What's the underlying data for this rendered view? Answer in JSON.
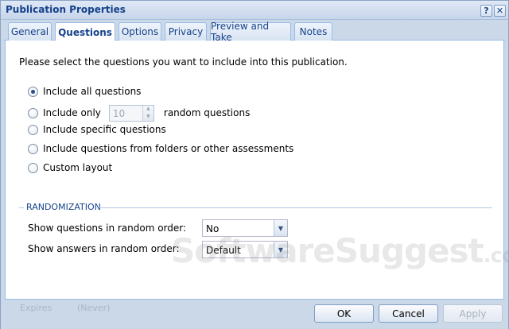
{
  "dialog": {
    "title": "Publication Properties",
    "help_glyph": "?",
    "close_glyph": "✕"
  },
  "tabs": [
    {
      "label": "General",
      "active": false
    },
    {
      "label": "Questions",
      "active": true
    },
    {
      "label": "Options",
      "active": false
    },
    {
      "label": "Privacy",
      "active": false
    },
    {
      "label": "Preview and Take",
      "active": false
    },
    {
      "label": "Notes",
      "active": false
    }
  ],
  "questions": {
    "intro": "Please select the questions you want to include into this publication.",
    "options": [
      {
        "label": "Include all questions",
        "checked": true
      },
      {
        "label": "Include only",
        "checked": false
      },
      {
        "label": "Include specific questions",
        "checked": false
      },
      {
        "label": "Include questions from folders or other assessments",
        "checked": false
      },
      {
        "label": "Custom layout",
        "checked": false
      }
    ],
    "include_only_count": "10",
    "include_only_suffix": "random questions"
  },
  "randomization": {
    "legend": "RANDOMIZATION",
    "questions_label": "Show questions in random order:",
    "questions_value": "No",
    "answers_label": "Show answers in random order:",
    "answers_value": "Default"
  },
  "footer": {
    "status_label": "Expires",
    "status_value": "(Never)",
    "ok_label": "OK",
    "cancel_label": "Cancel",
    "apply_label": "Apply"
  },
  "watermark": {
    "brand": "SoftwareSuggest",
    "suffix": ".com"
  },
  "colors": {
    "accent": "#15428b",
    "frame": "#cbd8e8",
    "tab_border": "#99bbe8"
  }
}
